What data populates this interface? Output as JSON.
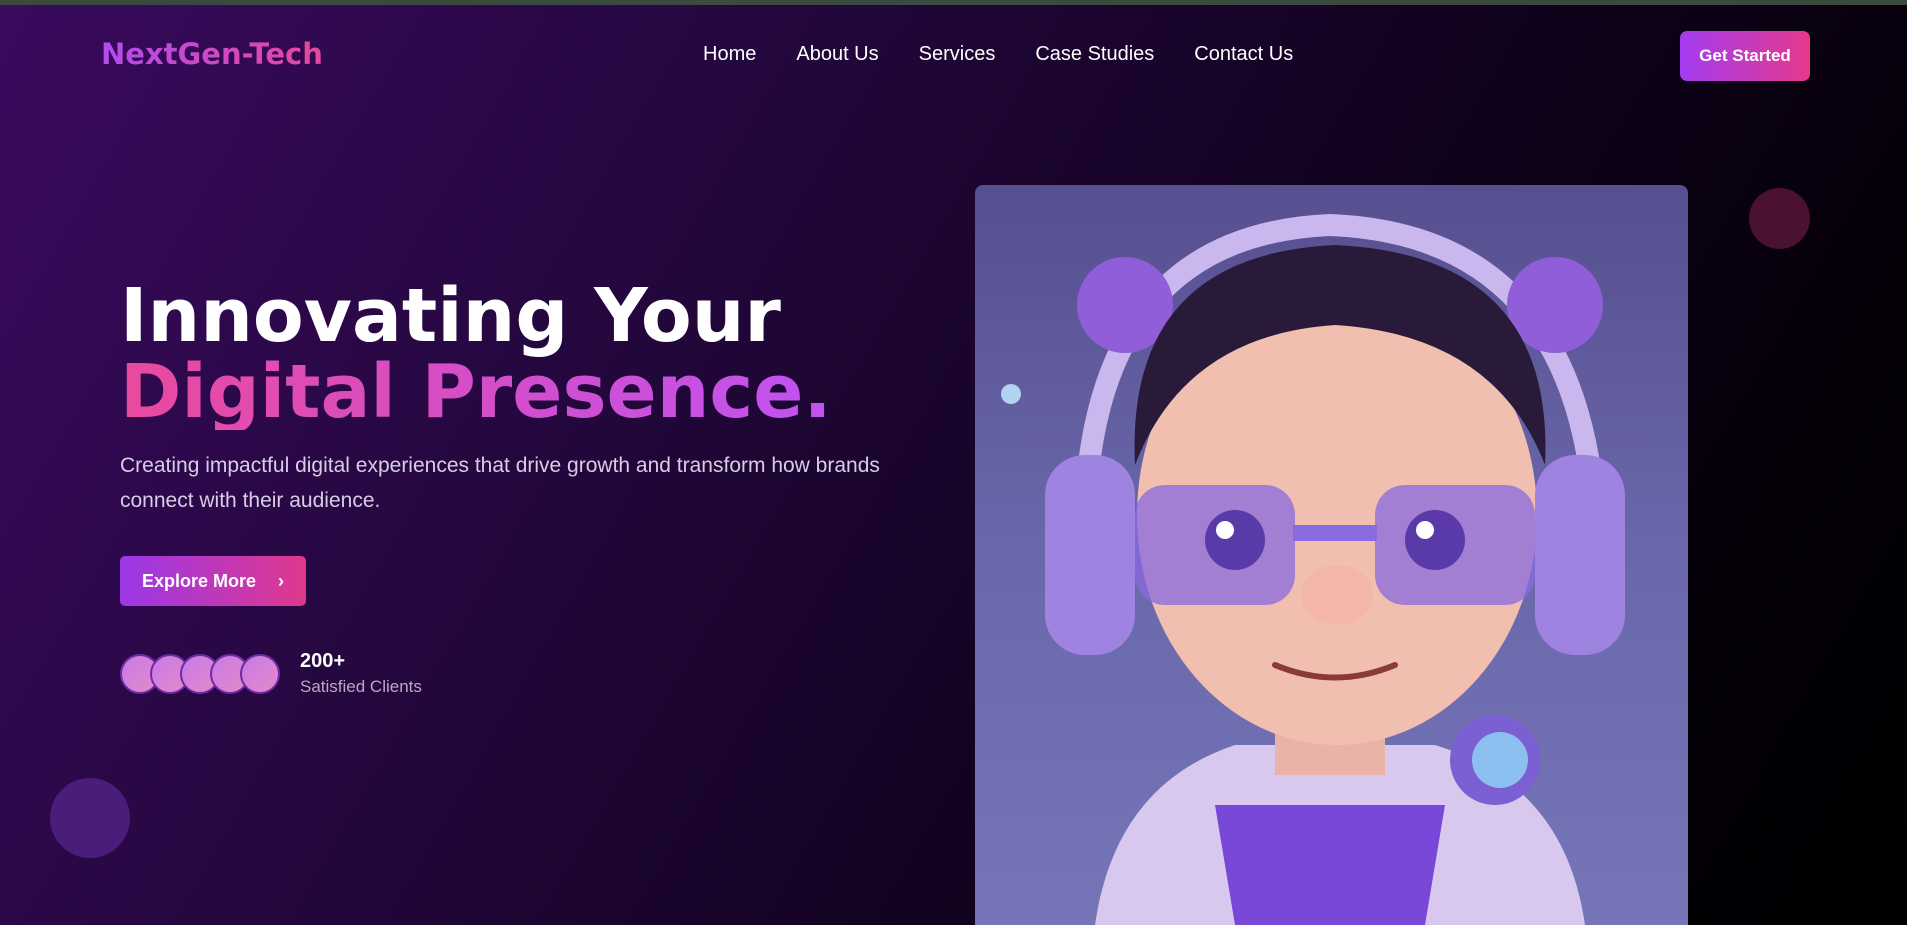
{
  "brand": {
    "name": "NextGen-Tech"
  },
  "nav": {
    "items": [
      "Home",
      "About Us",
      "Services",
      "Case Studies",
      "Contact Us"
    ]
  },
  "header": {
    "cta_label": "Get Started"
  },
  "hero": {
    "title_line1": "Innovating Your",
    "title_line2": "Digital Presence.",
    "subtitle": "Creating impactful digital experiences that drive growth and transform how brands connect with their audience.",
    "explore_label": "Explore More",
    "clients_count": "200+",
    "clients_label": "Satisfied Clients"
  },
  "colors": {
    "accent_start": "#a43bf0",
    "accent_end": "#e53a8b"
  }
}
